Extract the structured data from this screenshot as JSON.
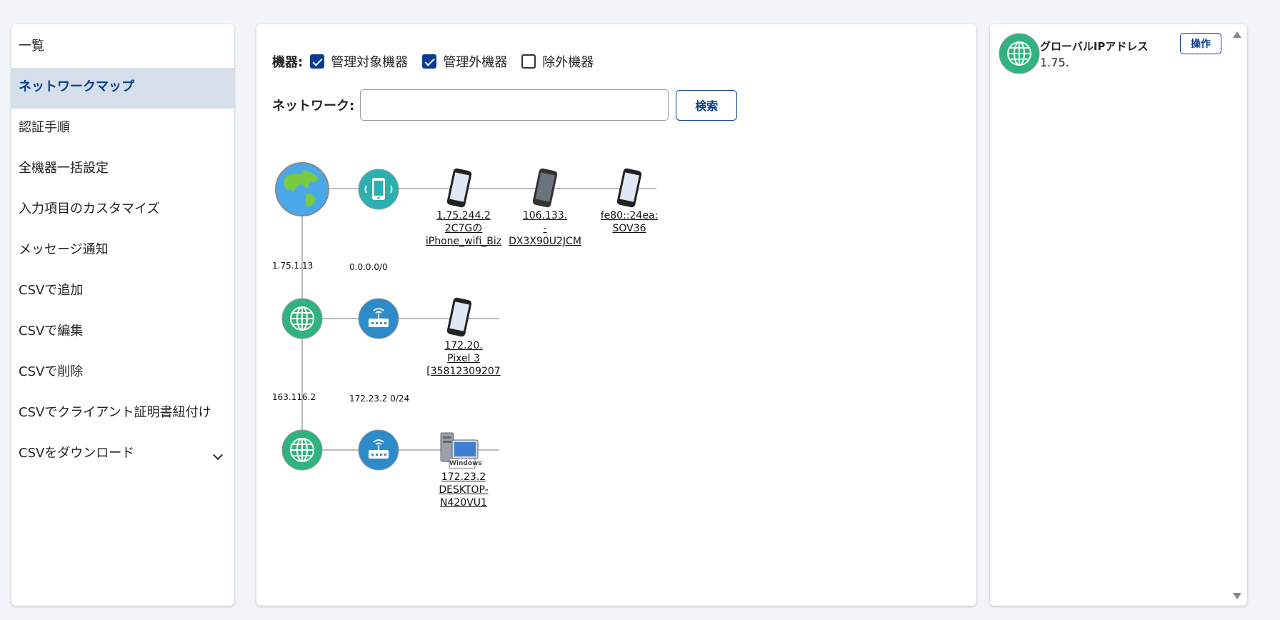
{
  "sidebar": {
    "items": [
      {
        "label": "一覧"
      },
      {
        "label": "ネットワークマップ"
      },
      {
        "label": "認証手順"
      },
      {
        "label": "全機器一括設定"
      },
      {
        "label": "入力項目のカスタマイズ"
      },
      {
        "label": "メッセージ通知"
      },
      {
        "label": "CSVで追加"
      },
      {
        "label": "CSVで編集"
      },
      {
        "label": "CSVで削除"
      },
      {
        "label": "CSVでクライアント証明書紐付け"
      },
      {
        "label": "CSVをダウンロード"
      }
    ]
  },
  "filters": {
    "label": "機器:",
    "options": [
      {
        "label": "管理対象機器",
        "checked": true
      },
      {
        "label": "管理外機器",
        "checked": true
      },
      {
        "label": "除外機器",
        "checked": false
      }
    ]
  },
  "network": {
    "label": "ネットワーク:",
    "value": "",
    "placeholder": "",
    "search_label": "検索"
  },
  "map": {
    "row1": {
      "devices": [
        {
          "line1": "1.75.244.2",
          "line2": "2C7Gの",
          "line3": "iPhone_wifi_Biz"
        },
        {
          "line1": "106.133.",
          "line2": "-",
          "line3": "DX3X90U2JCM"
        },
        {
          "line1": "fe80::24ea:",
          "line2": "",
          "line3": "SOV36"
        }
      ]
    },
    "row2": {
      "gateway_caption": "1.75.1.13",
      "router_caption": "0.0.0.0/0",
      "devices": [
        {
          "line1": "172.20.",
          "line2": "Pixel 3",
          "line3": "[35812309207"
        }
      ]
    },
    "row3": {
      "gateway_caption": "163.116.2",
      "router_caption": "172.23.2 0/24",
      "devices": [
        {
          "line1": "172.23.2",
          "line2": "DESKTOP-",
          "line3": "N420VU1",
          "badge": "Windows"
        }
      ]
    }
  },
  "info": {
    "title": "グローバルIPアドレス",
    "value": "1.75.",
    "action_label": "操作"
  },
  "colors": {
    "accent": "#0a3d8f",
    "active_bg": "#d4dfeb",
    "globe_green": "#2fb37f",
    "router_blue": "#2e8bc9",
    "mobile_teal": "#2bb0b0"
  }
}
